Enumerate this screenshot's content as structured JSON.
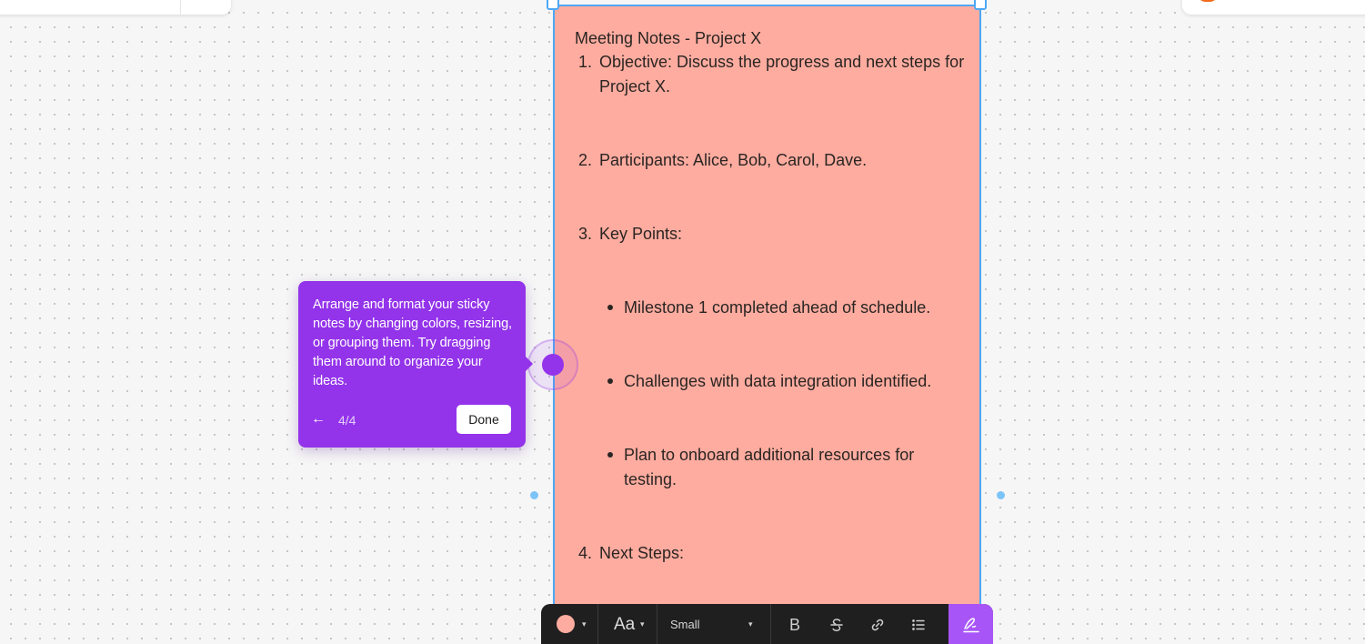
{
  "note": {
    "title": "Meeting Notes - Project X",
    "items": [
      {
        "number": "1.",
        "text": "Objective: Discuss the progress and next steps for Project X."
      },
      {
        "number": "2.",
        "text": "Participants: Alice, Bob, Carol, Dave."
      },
      {
        "number": "3.",
        "text": "Key Points:"
      },
      {
        "number": "4.",
        "text": "Next Steps:"
      }
    ],
    "bullets": [
      "Milestone 1 completed ahead of schedule.",
      "Challenges with data integration identified.",
      "Plan to onboard additional resources for testing."
    ],
    "color": "#ffaca0"
  },
  "tour": {
    "message": "Arrange and format your sticky notes by changing colors, resizing, or grouping them. Try dragging them around to organize your ideas.",
    "back_icon": "←",
    "step": "4/4",
    "done_label": "Done",
    "color": "#9333ea"
  },
  "toolbar": {
    "font_icon_label": "Aa",
    "size_label": "Small",
    "bold_label": "B",
    "icons": [
      "color-swatch",
      "chevron-down-icon",
      "font-icon",
      "bold-icon",
      "strikethrough-icon",
      "link-icon",
      "list-icon",
      "signature-icon"
    ],
    "accent": "#a855f7"
  },
  "colors": {
    "selection": "#4ea7f5",
    "canvas": "#f6f6f6"
  }
}
